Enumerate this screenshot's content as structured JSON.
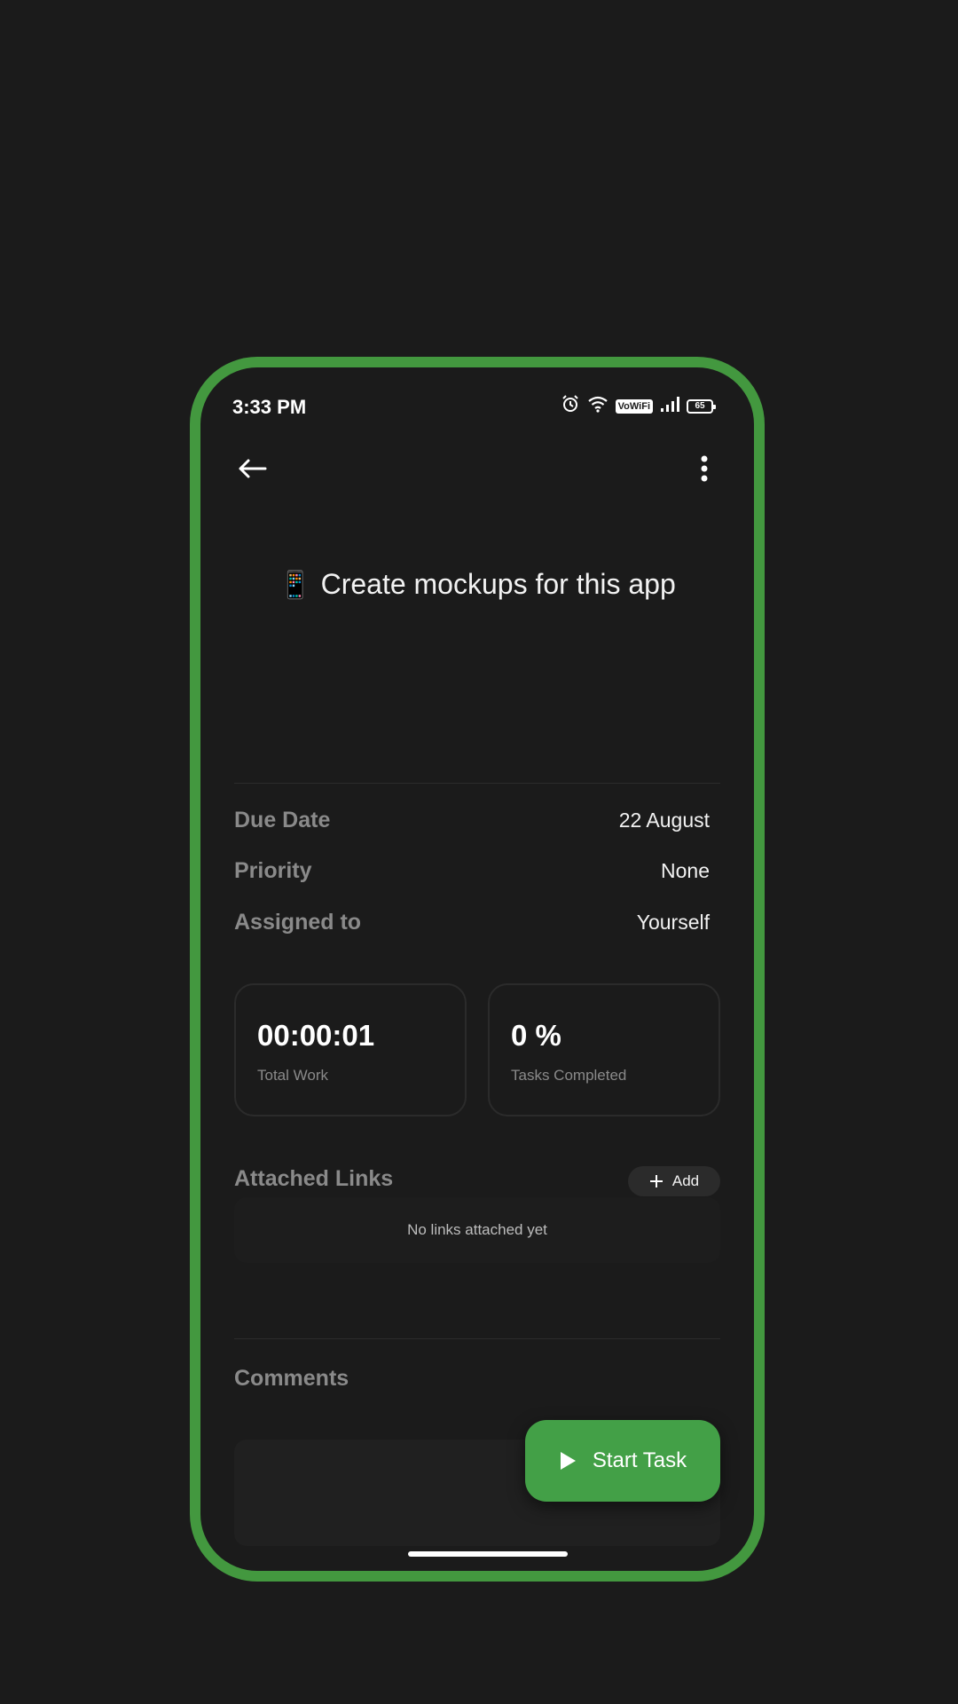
{
  "status_bar": {
    "time": "3:33 PM",
    "vowifi": "VoWiFi",
    "battery": "65",
    "icons": [
      "alarm-icon",
      "wifi-icon",
      "signal-icon",
      "battery-icon"
    ]
  },
  "toolbar": {
    "back_icon": "arrow-left-icon",
    "menu_icon": "more-vert-icon"
  },
  "task": {
    "emoji": "📱",
    "title": "Create mockups  for this app"
  },
  "details": {
    "due_date_label": "Due Date",
    "due_date_value": "22 August",
    "priority_label": "Priority",
    "priority_value": "None",
    "assigned_label": "Assigned to",
    "assigned_value": "Yourself"
  },
  "stats": {
    "total_work_value": "00:00:01",
    "total_work_label": "Total Work",
    "tasks_completed_value": "0 %",
    "tasks_completed_label": "Tasks Completed"
  },
  "links": {
    "title": "Attached Links",
    "add_label": "Add",
    "empty_text": "No links attached yet"
  },
  "comments": {
    "title": "Comments"
  },
  "fab": {
    "label": "Start Task",
    "icon": "play-icon"
  },
  "colors": {
    "frame": "#43983f",
    "accent": "#43a047",
    "background": "#1b1b1b"
  }
}
